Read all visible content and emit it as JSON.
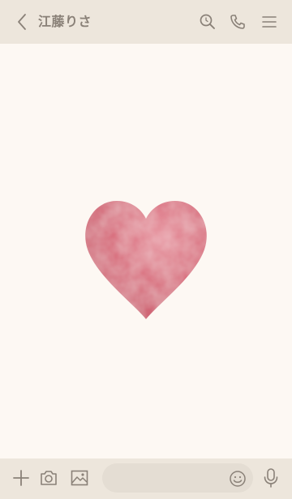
{
  "header": {
    "title": "江藤りさ",
    "icons": [
      "back-chevron-icon",
      "search-icon",
      "phone-icon",
      "menu-icon"
    ]
  },
  "footer": {
    "input_value": "",
    "input_placeholder": "",
    "icons": [
      "plus-icon",
      "camera-icon",
      "image-icon",
      "emoji-icon",
      "microphone-icon"
    ]
  },
  "background": {
    "image": "heart-watercolor",
    "heart_color": "#d96f80"
  },
  "colors": {
    "header_bg": "#ede6dc",
    "chat_bg": "#fdf8f3",
    "icon_color": "#8a8178",
    "input_bg": "#e4ddd3"
  }
}
